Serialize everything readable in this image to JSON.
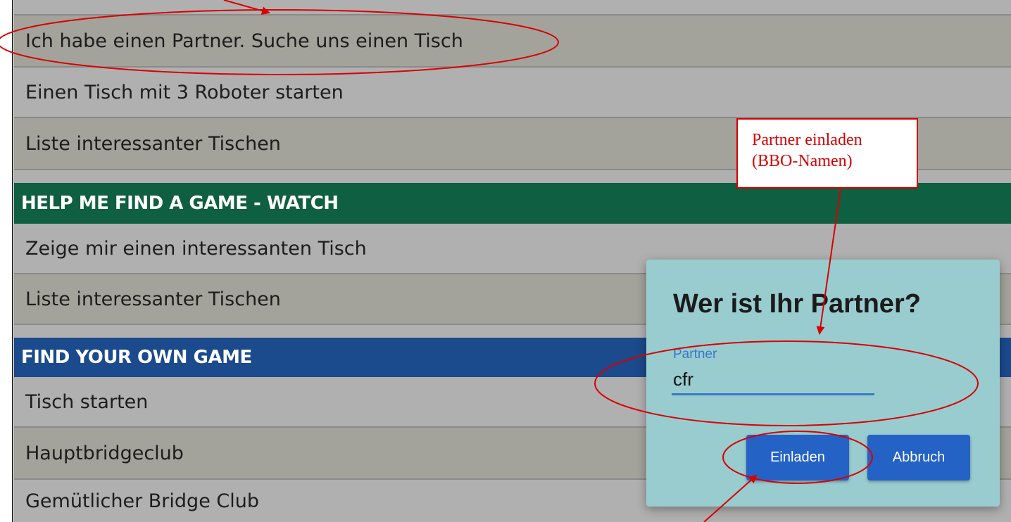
{
  "menu": {
    "items_top": [
      "Ich habe einen Partner. Suche uns einen Tisch",
      "Einen Tisch mit 3 Roboter starten",
      "Liste interessanter Tischen"
    ],
    "watch_section": "HELP ME FIND A GAME - WATCH",
    "watch_items": [
      "Zeige mir einen interessanten Tisch",
      "Liste interessanter Tischen"
    ],
    "own_section": "FIND YOUR OWN GAME",
    "own_items": [
      "Tisch starten",
      "Hauptbridgeclub",
      "Gemütlicher Bridge Club"
    ]
  },
  "dialog": {
    "title": "Wer ist Ihr Partner?",
    "field_label": "Partner",
    "field_value": "cfr",
    "invite_label": "Einladen",
    "cancel_label": "Abbruch"
  },
  "annotation": {
    "callout_line1": "Partner einladen",
    "callout_line2": "(BBO-Namen)",
    "color": "#d80000"
  },
  "colors": {
    "row_alt": "#a3a39b",
    "row_plain": "#b0b0b0",
    "section_green": "#0f5f42",
    "section_blue": "#1b4a8d",
    "dialog_bg": "#99cccf",
    "button_bg": "#2462c6"
  }
}
